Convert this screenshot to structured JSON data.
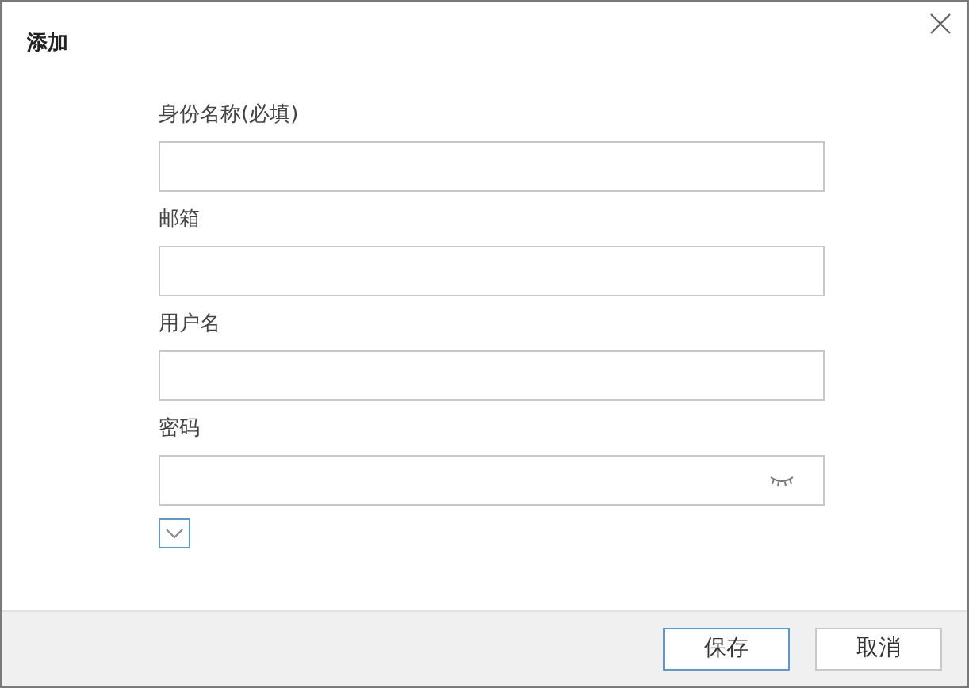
{
  "dialog": {
    "title": "添加"
  },
  "fields": [
    {
      "label": "身份名称(必填)",
      "kind": "text"
    },
    {
      "label": "邮箱",
      "kind": "text"
    },
    {
      "label": "用户名",
      "kind": "text"
    },
    {
      "label": "密码",
      "kind": "password"
    }
  ],
  "more_toggle": {
    "expanded": false
  },
  "buttons": [
    {
      "label": "保存",
      "default": true
    },
    {
      "label": "取消",
      "default": false
    }
  ]
}
